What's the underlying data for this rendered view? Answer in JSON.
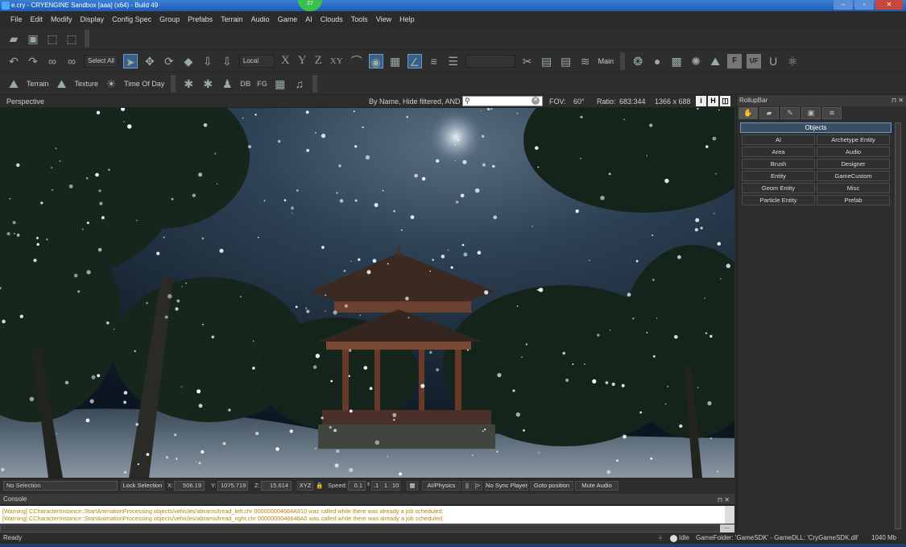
{
  "window": {
    "title": "e.cry - CRYENGINE Sandbox [aaa] (x64) - Build 49",
    "notification_count": "27",
    "minimize": "–",
    "maximize": "▫",
    "close": "✕"
  },
  "menu": [
    "File",
    "Edit",
    "Modify",
    "Display",
    "Config Spec",
    "Group",
    "Prefabs",
    "Terrain",
    "Audio",
    "Game",
    "AI",
    "Clouds",
    "Tools",
    "View",
    "Help"
  ],
  "toolbar": {
    "select_all": "Select All",
    "coord_system": "Local",
    "axis_x": "X",
    "axis_y": "Y",
    "axis_z": "Z",
    "axis_xy": "XY",
    "layer": "Main",
    "terrain": "Terrain",
    "texture": "Texture",
    "time_of_day": "Time Of Day",
    "db": "DB",
    "fg": "FG",
    "f": "F",
    "uf": "UF"
  },
  "viewport": {
    "title": "Perspective",
    "filter": "By Name, Hide filtered, AND",
    "search_placeholder": "",
    "fov_label": "FOV:",
    "fov_value": "60°",
    "ratio_label": "Ratio:",
    "ratio_value": "683:344",
    "resolution": "1366 x 688",
    "btn_i": "i",
    "btn_h": "H"
  },
  "vp_status": {
    "selection": "No Selection",
    "lock_selection": "Lock Selection",
    "x_label": "X:",
    "x_value": "506.19",
    "y_label": "Y:",
    "y_value": "1075.719",
    "z_label": "Z:",
    "z_value": "15.614",
    "xyz": "XYZ",
    "speed_label": "Speed:",
    "speed_value": "0.1",
    "speed_1": ".1",
    "speed_2": "1",
    "speed_3": "10",
    "ai_physics": "AI/Physics",
    "pause": "||",
    "step": "|>",
    "no_sync_player": "No Sync Player",
    "goto_position": "Goto position",
    "mute_audio": "Mute Audio"
  },
  "console": {
    "title": "Console",
    "lines": [
      "[Warning] CCharacterInstance::StartAnimationProcessing objects/vehicles/abrams/tread_left.chr 000000004664A910 was called while there was already a job scheduled.",
      "[Warning] CCharacterInstance::StartAnimationProcessing objects/vehicles/abrams/tread_right.chr 0000000046648A0 was called while there was already a job scheduled."
    ],
    "more": "..."
  },
  "status": {
    "ready": "Ready",
    "idle": "Idle",
    "gamefolder": "GameFolder: 'GameSDK' - GameDLL: 'CryGameSDK.dll'",
    "memory": "1040 Mb"
  },
  "rollup": {
    "title": "RollupBar",
    "objects_header": "Objects",
    "buttons": [
      "AI",
      "Archetype Entity",
      "Area",
      "Audio",
      "Brush",
      "Designer",
      "Entity",
      "GameCustom",
      "Geom Entity",
      "Misc",
      "Particle Entity",
      "Prefab"
    ]
  },
  "colors": {
    "accent": "#5da0e0",
    "warning": "#b8860b",
    "viewport_sky": "#1a2a3a"
  }
}
